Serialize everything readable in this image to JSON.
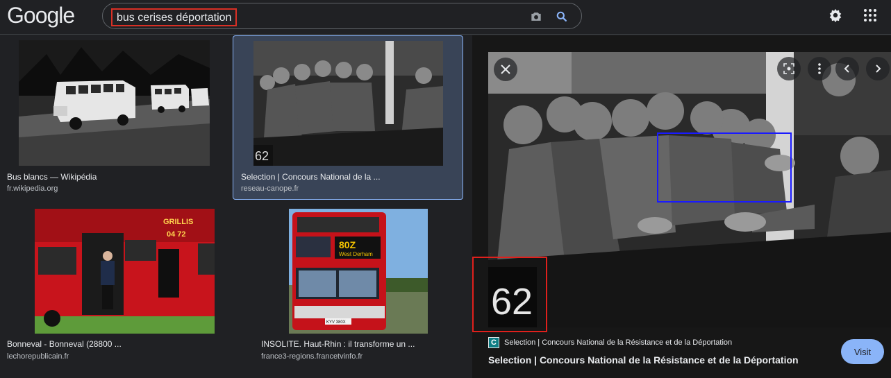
{
  "header": {
    "logo": "Google",
    "search_query": "bus cerises déportation"
  },
  "results": [
    {
      "title": "Bus blancs — Wikipédia",
      "site": "fr.wikipedia.org"
    },
    {
      "title": "Selection | Concours National de la ...",
      "site": "reseau-canope.fr"
    },
    {
      "title": "Bonneval - Bonneval (28800 ...",
      "site": "lechorepublicain.fr"
    },
    {
      "title": "INSOLITE. Haut-Rhin : il transforme un ...",
      "site": "france3-regions.francetvinfo.fr"
    }
  ],
  "bus_sign": {
    "route": "80Z",
    "destination": "West Derham",
    "plate": "KYV 380X"
  },
  "preview": {
    "favicon_letter": "C",
    "source": "Selection | Concours National de la Résistance et de la Déportation",
    "title": "Selection | Concours National de la Résistance et de la Déportation",
    "visit_label": "Visit",
    "number_plate": "62"
  },
  "colors": {
    "accent": "#8ab4f8",
    "background": "#202124",
    "highlight_red": "#e0201c",
    "highlight_blue": "#1a1aff"
  }
}
